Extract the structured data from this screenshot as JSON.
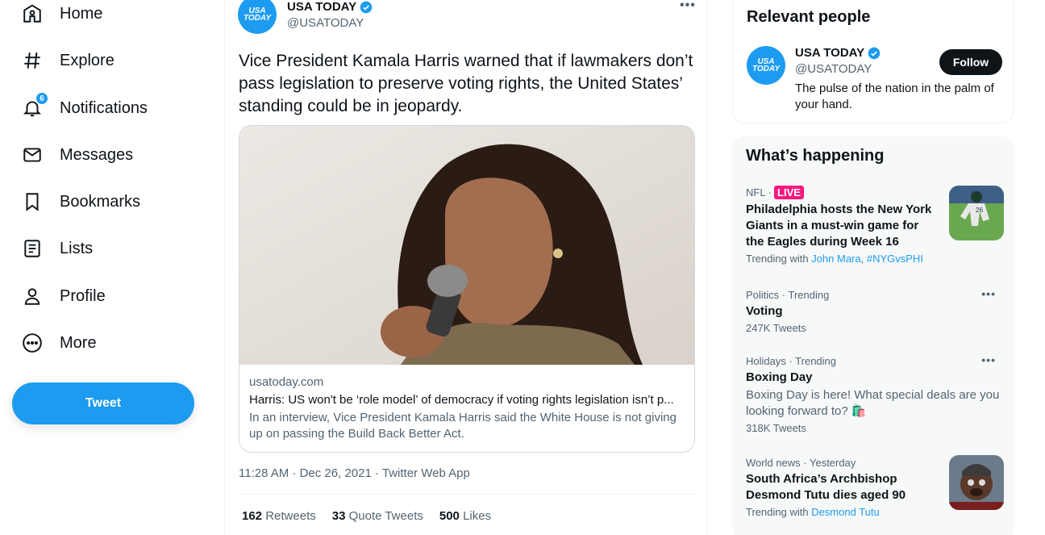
{
  "nav": {
    "items": [
      {
        "label": "Home",
        "icon": "home-icon"
      },
      {
        "label": "Explore",
        "icon": "hashtag-icon"
      },
      {
        "label": "Notifications",
        "icon": "bell-icon"
      },
      {
        "label": "Messages",
        "icon": "envelope-icon"
      },
      {
        "label": "Bookmarks",
        "icon": "bookmark-icon"
      },
      {
        "label": "Lists",
        "icon": "list-icon"
      },
      {
        "label": "Profile",
        "icon": "person-icon"
      },
      {
        "label": "More",
        "icon": "more-circle-icon"
      }
    ],
    "notification_count": "6",
    "tweet_button": "Tweet"
  },
  "tweet": {
    "author_name": "USA TODAY",
    "author_handle": "@USATODAY",
    "avatar_text_1": "USA",
    "avatar_text_2": "TODAY",
    "text": "Vice President Kamala Harris warned that if lawmakers don’t pass legislation to preserve voting rights, the United States’ standing could be in jeopardy.",
    "card": {
      "domain": "usatoday.com",
      "title": "Harris: US won't be ‘role model’ of democracy if voting rights legislation isn’t p...",
      "description": "In an interview, Vice President Kamala Harris said the White House is not giving up on passing the Build Back Better Act."
    },
    "meta": "11:28 AM · Dec 26, 2021 · Twitter Web App",
    "stats": {
      "retweets_count": "162",
      "retweets_label": "Retweets",
      "quote_count": "33",
      "quote_label": "Quote Tweets",
      "likes_count": "500",
      "likes_label": "Likes"
    }
  },
  "relevant_people": {
    "title": "Relevant people",
    "name": "USA TODAY",
    "handle": "@USATODAY",
    "bio": "The pulse of the nation in the palm of your hand.",
    "follow_label": "Follow"
  },
  "happening": {
    "title": "What’s happening",
    "trends": [
      {
        "context": "NFL ·",
        "live": "LIVE",
        "title": "Philadelphia hosts the New York Giants in a must-win game for the Eagles during Week 16",
        "sub_prefix": "Trending with",
        "sub_link": "John Mara",
        "sub_sep": ",",
        "sub_link2": "#NYGvsPHI"
      },
      {
        "context": "Politics · Trending",
        "title": "Voting",
        "count": "247K Tweets"
      },
      {
        "context": "Holidays · Trending",
        "title": "Boxing Day",
        "description": "Boxing Day is here! What special deals are you looking forward to? 🛍️",
        "count": "318K Tweets"
      },
      {
        "context": "World news · Yesterday",
        "title": "South Africa’s Archbishop Desmond Tutu dies aged 90",
        "sub_prefix": "Trending with",
        "sub_link": "Desmond Tutu"
      }
    ]
  },
  "colors": {
    "accent": "#1d9bf0",
    "live": "#f91880",
    "text": "#0f1419",
    "muted": "#536471"
  }
}
